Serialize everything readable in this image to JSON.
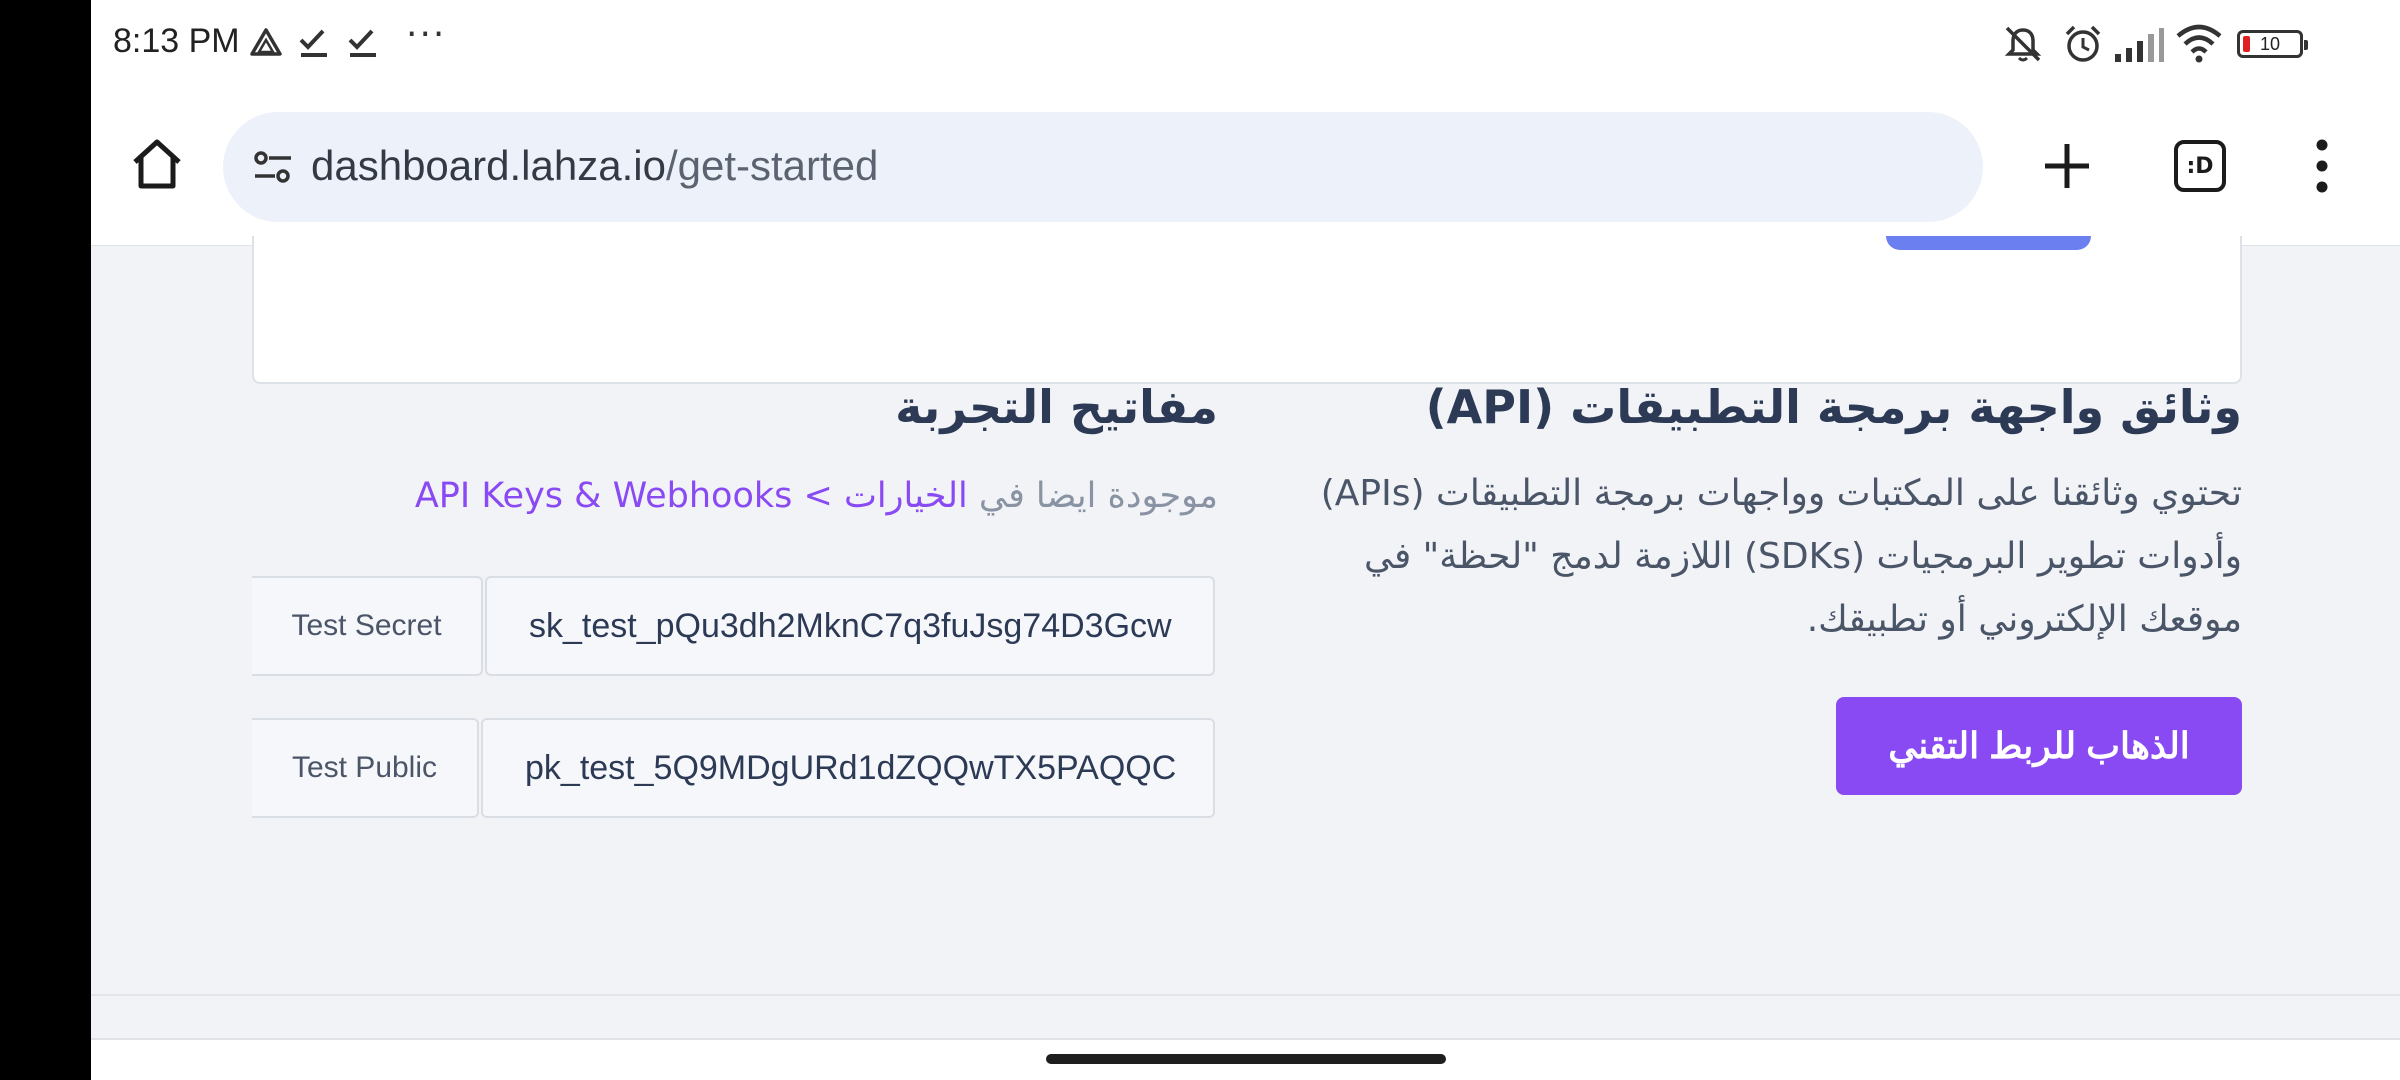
{
  "status_bar": {
    "time": "8:13 PM",
    "more": "···",
    "battery": "10"
  },
  "browser": {
    "url_host": "dashboard.lahza.io",
    "url_path": "/get-started",
    "tabs_label": ":D"
  },
  "api_docs": {
    "title": "وثائق واجهة برمجة التطبيقات (API)",
    "description_lines": [
      "تحتوي وثائقنا على المكتبات وواجهات برمجة التطبيقات (APIs)",
      "وأدوات تطوير البرمجيات (SDKs) اللازمة لدمج \"لحظة\" في",
      "موقعك الإلكتروني أو تطبيقك."
    ],
    "button_label": "الذهاب للربط التقني"
  },
  "test_keys": {
    "title": "مفاتيح التجربة",
    "note_prefix": "موجودة ايضا في ",
    "note_link": "الخيارات > API Keys & Webhooks",
    "secret": {
      "label": "Test Secret",
      "value": "sk_test_pQu3dh2MknC7q3fuJsg74D3Gcw"
    },
    "public": {
      "label": "Test Public",
      "value": "pk_test_5Q9MDgURd1dZQQwTX5PAQQC"
    }
  },
  "colors": {
    "accent": "#8a4af3",
    "heading": "#2c3a55",
    "page_bg": "#f1f3f7"
  }
}
